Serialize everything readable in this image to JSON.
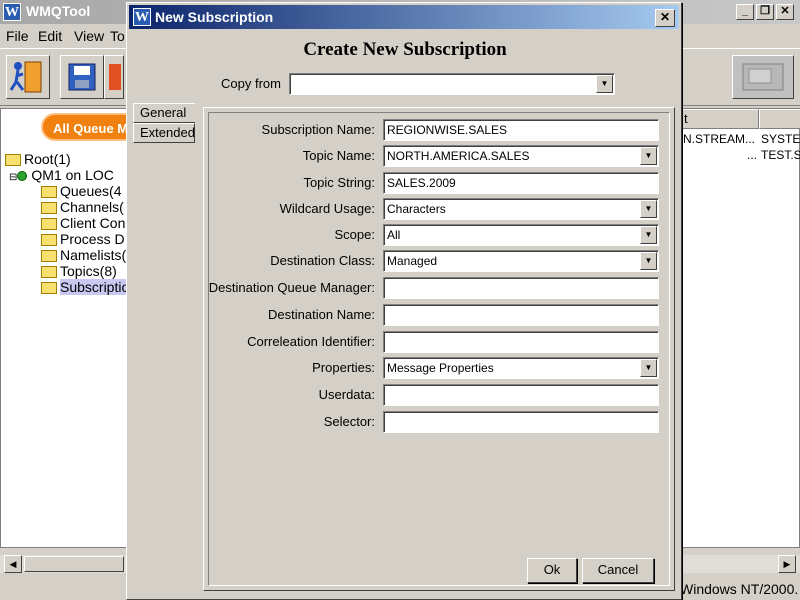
{
  "main_window": {
    "title": "WMQTool",
    "menu": [
      "File",
      "Edit",
      "View",
      "To"
    ],
    "queue_tab_label": "All Queue M",
    "tree": [
      {
        "label": "Root(1)",
        "type": "folder"
      },
      {
        "label": "QM1 on LOC",
        "type": "qmgr"
      },
      {
        "label": "Queues(4",
        "type": "folder"
      },
      {
        "label": "Channels(",
        "type": "folder"
      },
      {
        "label": "Client Con",
        "type": "folder"
      },
      {
        "label": "Process D",
        "type": "folder"
      },
      {
        "label": "Namelists(",
        "type": "folder"
      },
      {
        "label": "Topics(8)",
        "type": "folder"
      },
      {
        "label": "Subscriptio",
        "type": "folder",
        "selected": true
      }
    ],
    "table": {
      "headers": [
        "t",
        ""
      ],
      "rows": [
        [
          "N.STREAM...",
          "SYSTE"
        ],
        [
          "...",
          "TEST.S"
        ]
      ]
    },
    "status_text": "Windows NT/2000."
  },
  "dialog": {
    "title": "New Subscription",
    "heading": "Create New Subscription",
    "copy_from": {
      "label": "Copy from",
      "value": ""
    },
    "tabs": [
      "General",
      "Extended"
    ],
    "fields": [
      {
        "label": "Subscription Name:",
        "value": "REGIONWISE.SALES",
        "kind": "text"
      },
      {
        "label": "Topic Name:",
        "value": "NORTH.AMERICA.SALES",
        "kind": "combo"
      },
      {
        "label": "Topic String:",
        "value": "SALES.2009",
        "kind": "text"
      },
      {
        "label": "Wildcard Usage:",
        "value": "Characters",
        "kind": "combo"
      },
      {
        "label": "Scope:",
        "value": "All",
        "kind": "combo"
      },
      {
        "label": "Destination Class:",
        "value": "Managed",
        "kind": "combo"
      },
      {
        "label": "Destination Queue Manager:",
        "value": "",
        "kind": "text"
      },
      {
        "label": "Destination Name:",
        "value": "",
        "kind": "text"
      },
      {
        "label": "Correleation Identifier:",
        "value": "",
        "kind": "text"
      },
      {
        "label": "Properties:",
        "value": "Message Properties",
        "kind": "combo"
      },
      {
        "label": "Userdata:",
        "value": "",
        "kind": "text"
      },
      {
        "label": "Selector:",
        "value": "",
        "kind": "text"
      }
    ],
    "ok_label": "Ok",
    "cancel_label": "Cancel"
  },
  "colors": {
    "dialog_title_gradient_start": "#0a246a",
    "dialog_title_gradient_end": "#a6caf0",
    "queue_tab": "#f08010",
    "window_bg": "#d4d0c8"
  },
  "icons": {
    "close": "close-icon",
    "dropdown": "chevron-down-icon",
    "folder": "folder-icon",
    "app": "wmq-app-icon"
  }
}
